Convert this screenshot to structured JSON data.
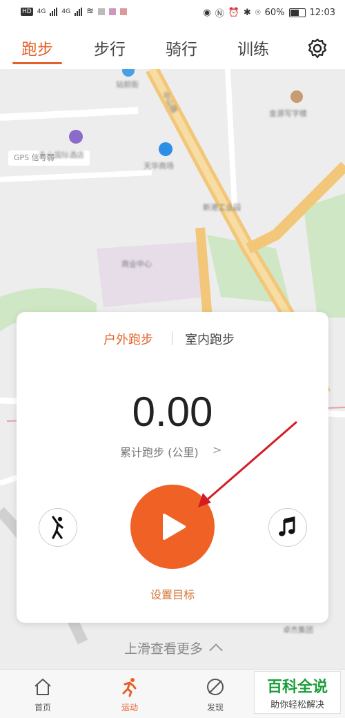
{
  "status_bar": {
    "hd": "HD",
    "net1": "4G",
    "net2": "4G",
    "battery": "60%",
    "time": "12:03"
  },
  "tabs": [
    {
      "label": "跑步",
      "active": true
    },
    {
      "label": "步行",
      "active": false
    },
    {
      "label": "骑行",
      "active": false
    },
    {
      "label": "训练",
      "active": false
    }
  ],
  "map": {
    "gps_label": "GPS 信号弱",
    "places": [
      "站前街",
      "天元国际酒店",
      "天华商场",
      "新港工业园",
      "商业中心",
      "金源写字楼",
      "卓杰集团",
      "中山路"
    ]
  },
  "card": {
    "mode_outdoor": "户外跑步",
    "mode_indoor": "室内跑步",
    "distance": "0.00",
    "distance_label": "累计跑步 (公里)",
    "goal_label": "设置目标"
  },
  "swipe_hint": "上滑查看更多",
  "bottom_nav": [
    {
      "label": "首页",
      "icon": "home-icon",
      "active": false
    },
    {
      "label": "运动",
      "icon": "running-icon",
      "active": true
    },
    {
      "label": "发现",
      "icon": "discover-icon",
      "active": false
    }
  ],
  "watermark": {
    "title": "百科全说",
    "subtitle": "助你轻松解决"
  },
  "colors": {
    "accent": "#e5612a",
    "play": "#ef6125",
    "arrow": "#d41c24",
    "watermark_green": "#1b9e3a"
  }
}
